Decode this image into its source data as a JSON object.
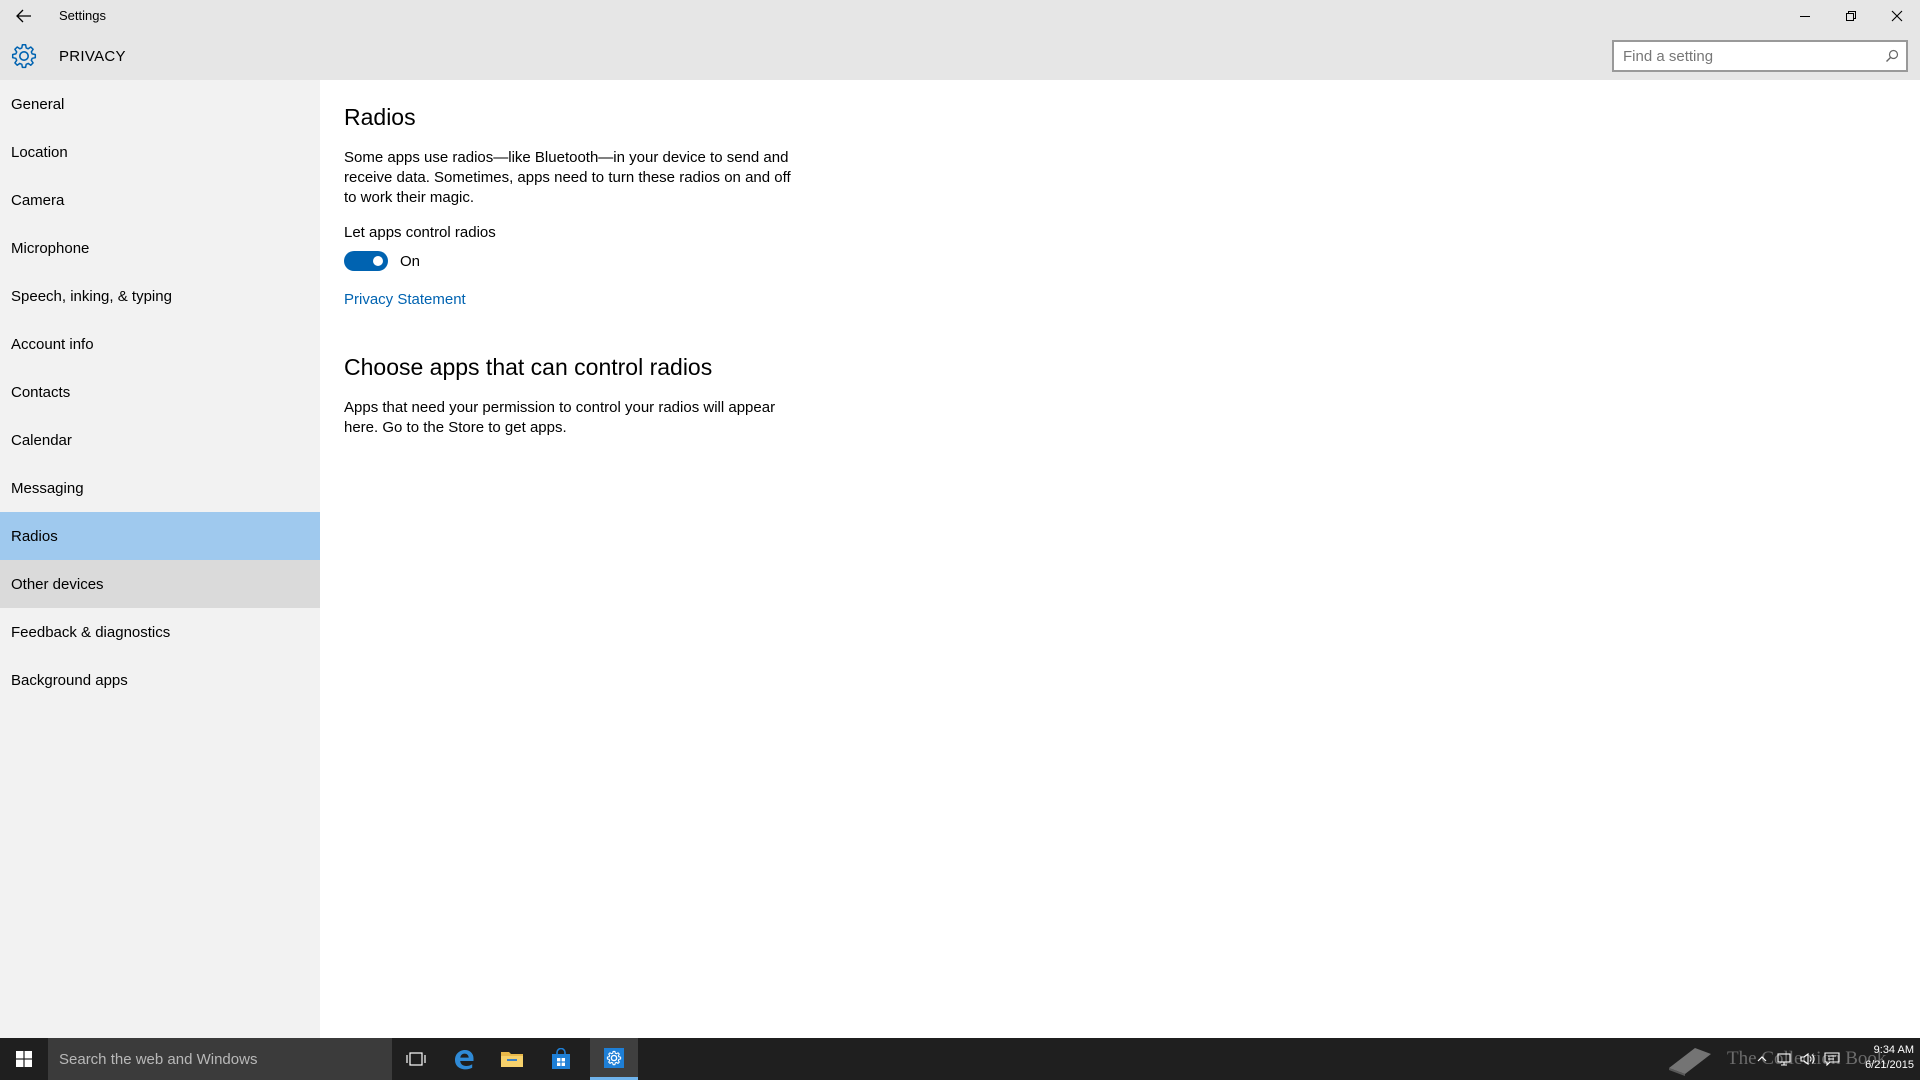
{
  "window": {
    "title": "Settings",
    "back_icon": "back-arrow-icon",
    "minimize_icon": "minimize-icon",
    "restore_icon": "restore-icon",
    "close_icon": "close-icon"
  },
  "header": {
    "title": "PRIVACY",
    "icon": "gear-icon",
    "search_placeholder": "Find a setting",
    "search_value": ""
  },
  "sidebar": {
    "items": [
      {
        "label": "General"
      },
      {
        "label": "Location"
      },
      {
        "label": "Camera"
      },
      {
        "label": "Microphone"
      },
      {
        "label": "Speech, inking, & typing"
      },
      {
        "label": "Account info"
      },
      {
        "label": "Contacts"
      },
      {
        "label": "Calendar"
      },
      {
        "label": "Messaging"
      },
      {
        "label": "Radios"
      },
      {
        "label": "Other devices"
      },
      {
        "label": "Feedback & diagnostics"
      },
      {
        "label": "Background apps"
      }
    ]
  },
  "main": {
    "title": "Radios",
    "description": "Some apps use radios—like Bluetooth—in your device to send and receive data. Sometimes, apps need to turn these radios on and off to work their magic.",
    "toggle_label": "Let apps control radios",
    "toggle_state": "On",
    "toggle_on": true,
    "privacy_link": "Privacy Statement",
    "section_title": "Choose apps that can control radios",
    "section_description": "Apps that need your permission to control your radios will appear here. Go to the Store to get apps."
  },
  "taskbar": {
    "search_placeholder": "Search the web and Windows",
    "watermark": "The Collection Book",
    "time": "9:34 AM",
    "date": "6/21/2015"
  },
  "colors": {
    "accent": "#0063b1",
    "selected_item": "#9fc9ee",
    "sidebar_bg": "#f2f2f2",
    "header_bg": "#e6e6e6",
    "taskbar_bg": "#1f1f1f"
  }
}
